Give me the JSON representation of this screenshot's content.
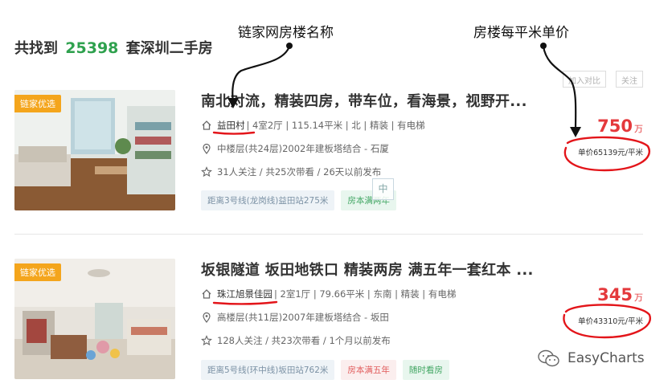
{
  "summary": {
    "prefix": "共找到",
    "count": "25398",
    "suffix": "套深圳二手房"
  },
  "annotations": {
    "left_label": "链家网房楼名称",
    "right_label": "房楼每平米单价"
  },
  "actions": {
    "compare_label": "加入对比",
    "follow_label": "关注"
  },
  "colors": {
    "accent_green": "#2fa14e",
    "price_red": "#e4393c",
    "badge_orange": "#f4a51c",
    "annotation_red": "#e3151a"
  },
  "listings": [
    {
      "badge": "链家优选",
      "title": "南北对流，精装四房，带车位，看海景，视野开...",
      "community": "益田村",
      "house_info": "| 4室2厅 | 115.14平米 | 北 | 精装 | 有电梯",
      "position_info": "中楼层(共24层)2002年建板塔结合 - 石厦",
      "follow_info": "31人关注 / 共25次带看 / 26天以前发布",
      "tags": [
        "距离3号线(龙岗线)益田站275米",
        "房本满两年"
      ],
      "total_price": "750",
      "price_unit": "万",
      "unit_price": "单价65139元/平米"
    },
    {
      "badge": "链家优选",
      "title": "坂银隧道 坂田地铁口 精装两房 满五年一套红本 ...",
      "community": "珠江旭景佳园",
      "house_info": "| 2室1厅 | 79.66平米 | 东南 | 精装 | 有电梯",
      "position_info": "高楼层(共11层)2007年建板塔结合 - 坂田",
      "follow_info": "128人关注 / 共23次带看 / 1个月以前发布",
      "tags": [
        "距离5号线(环中线)坂田站762米",
        "房本满五年",
        "随时看房"
      ],
      "total_price": "345",
      "price_unit": "万",
      "unit_price": "单价43310元/平米"
    }
  ],
  "overlay_char": "中",
  "watermark": {
    "text": "EasyCharts"
  }
}
